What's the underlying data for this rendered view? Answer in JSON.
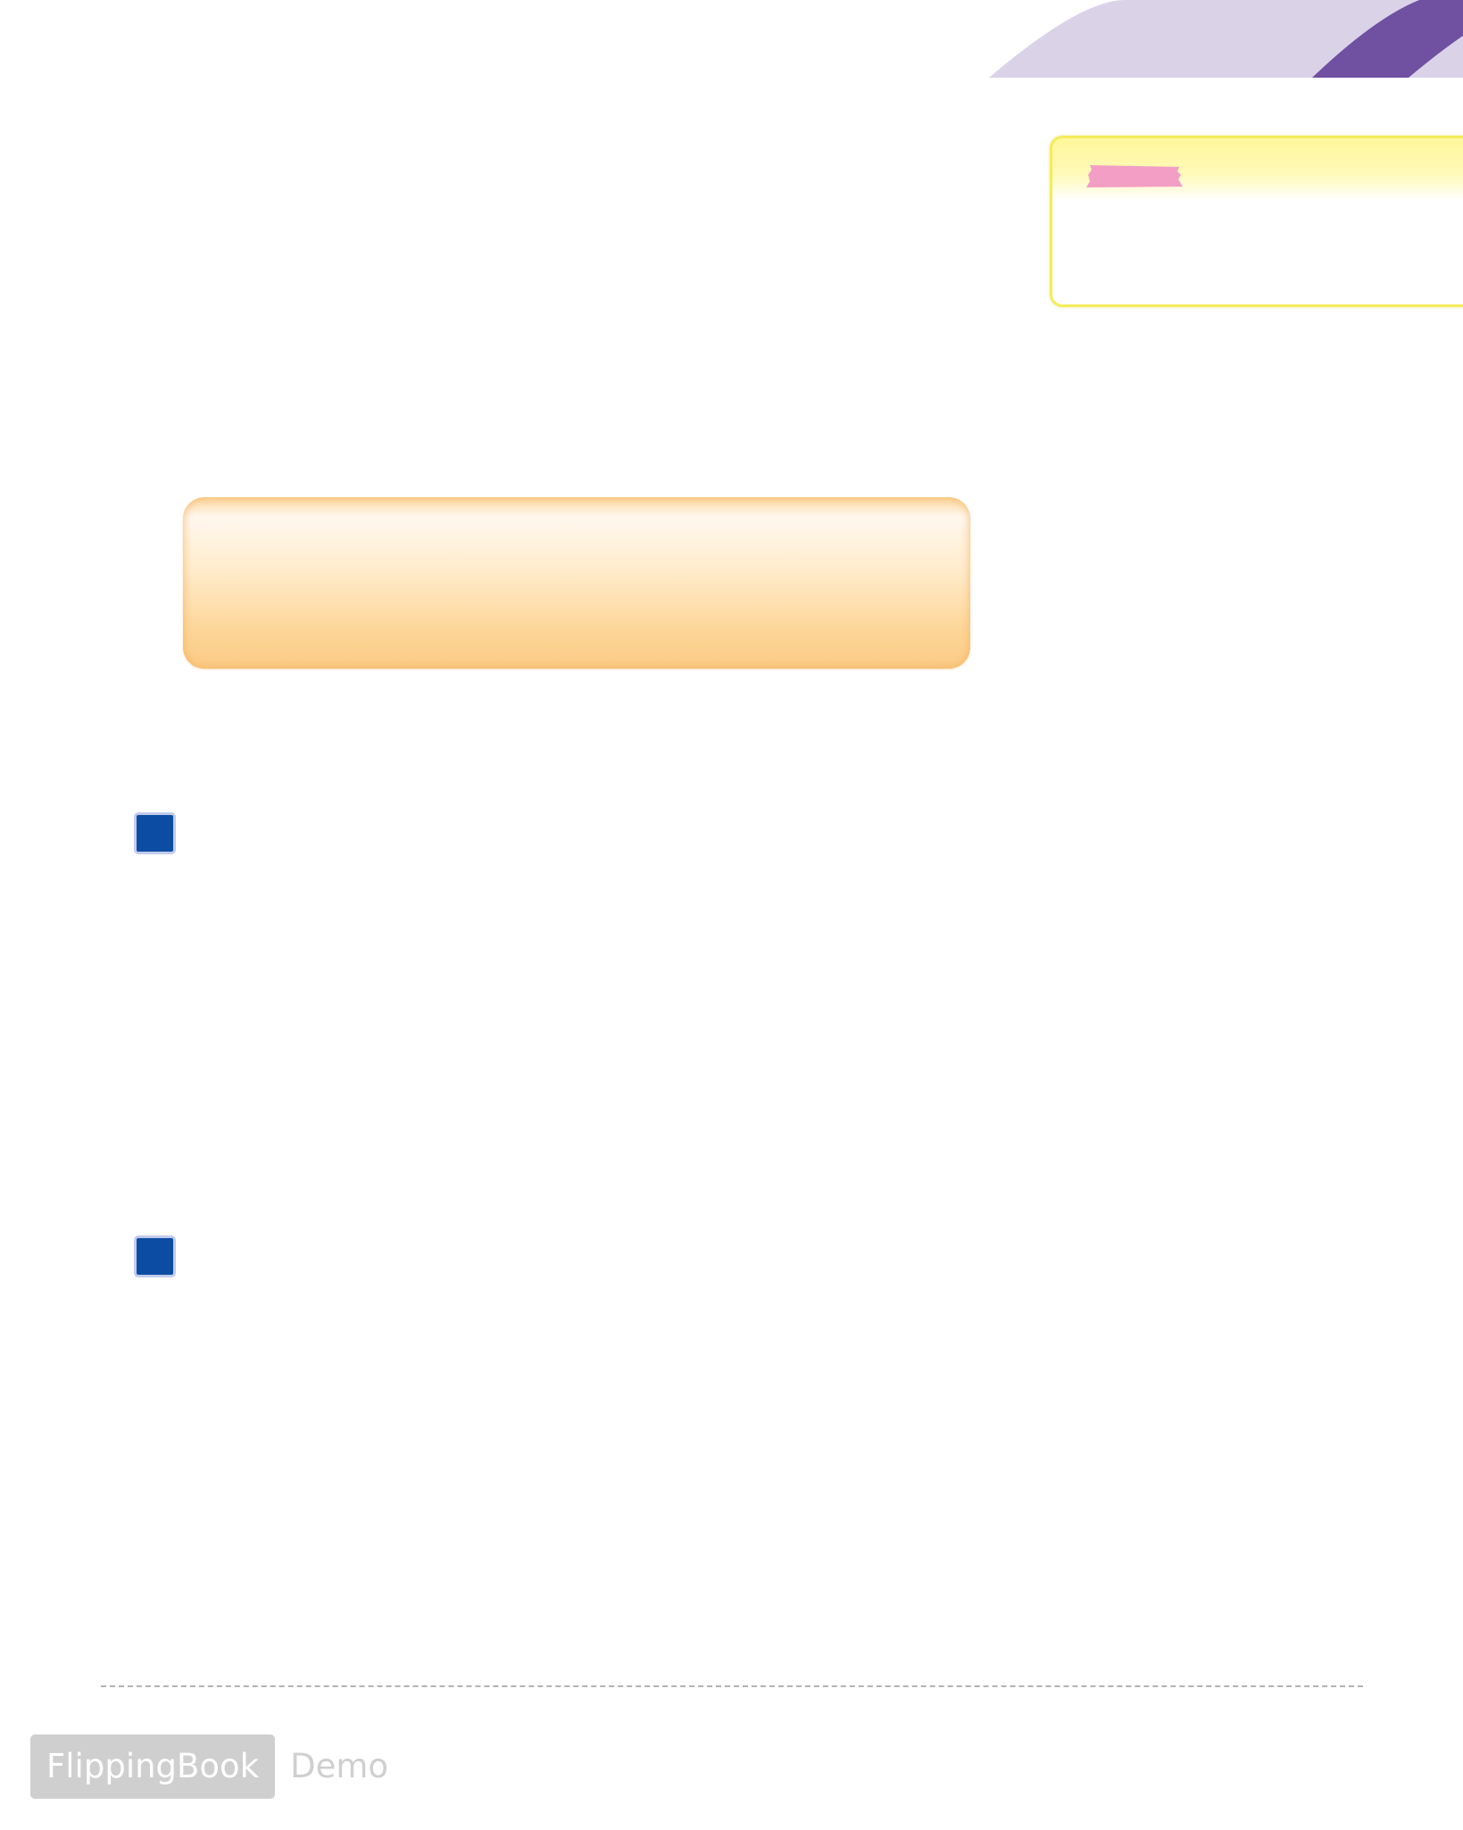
{
  "colors": {
    "arc_light": "#dad3e8",
    "arc_dark": "#6f50a1",
    "note_border": "#f4ec5c",
    "tape": "#f29ec5",
    "banner": "#fbcb86",
    "checkbox": "#0d4ca3",
    "divider": "#b3b3b3",
    "watermark": "#cfcfcf"
  },
  "icons": {
    "tape": "tape-strip",
    "checkbox": "square-bullet"
  },
  "watermark": {
    "brand": "FlippingBook",
    "suffix": "Demo"
  }
}
